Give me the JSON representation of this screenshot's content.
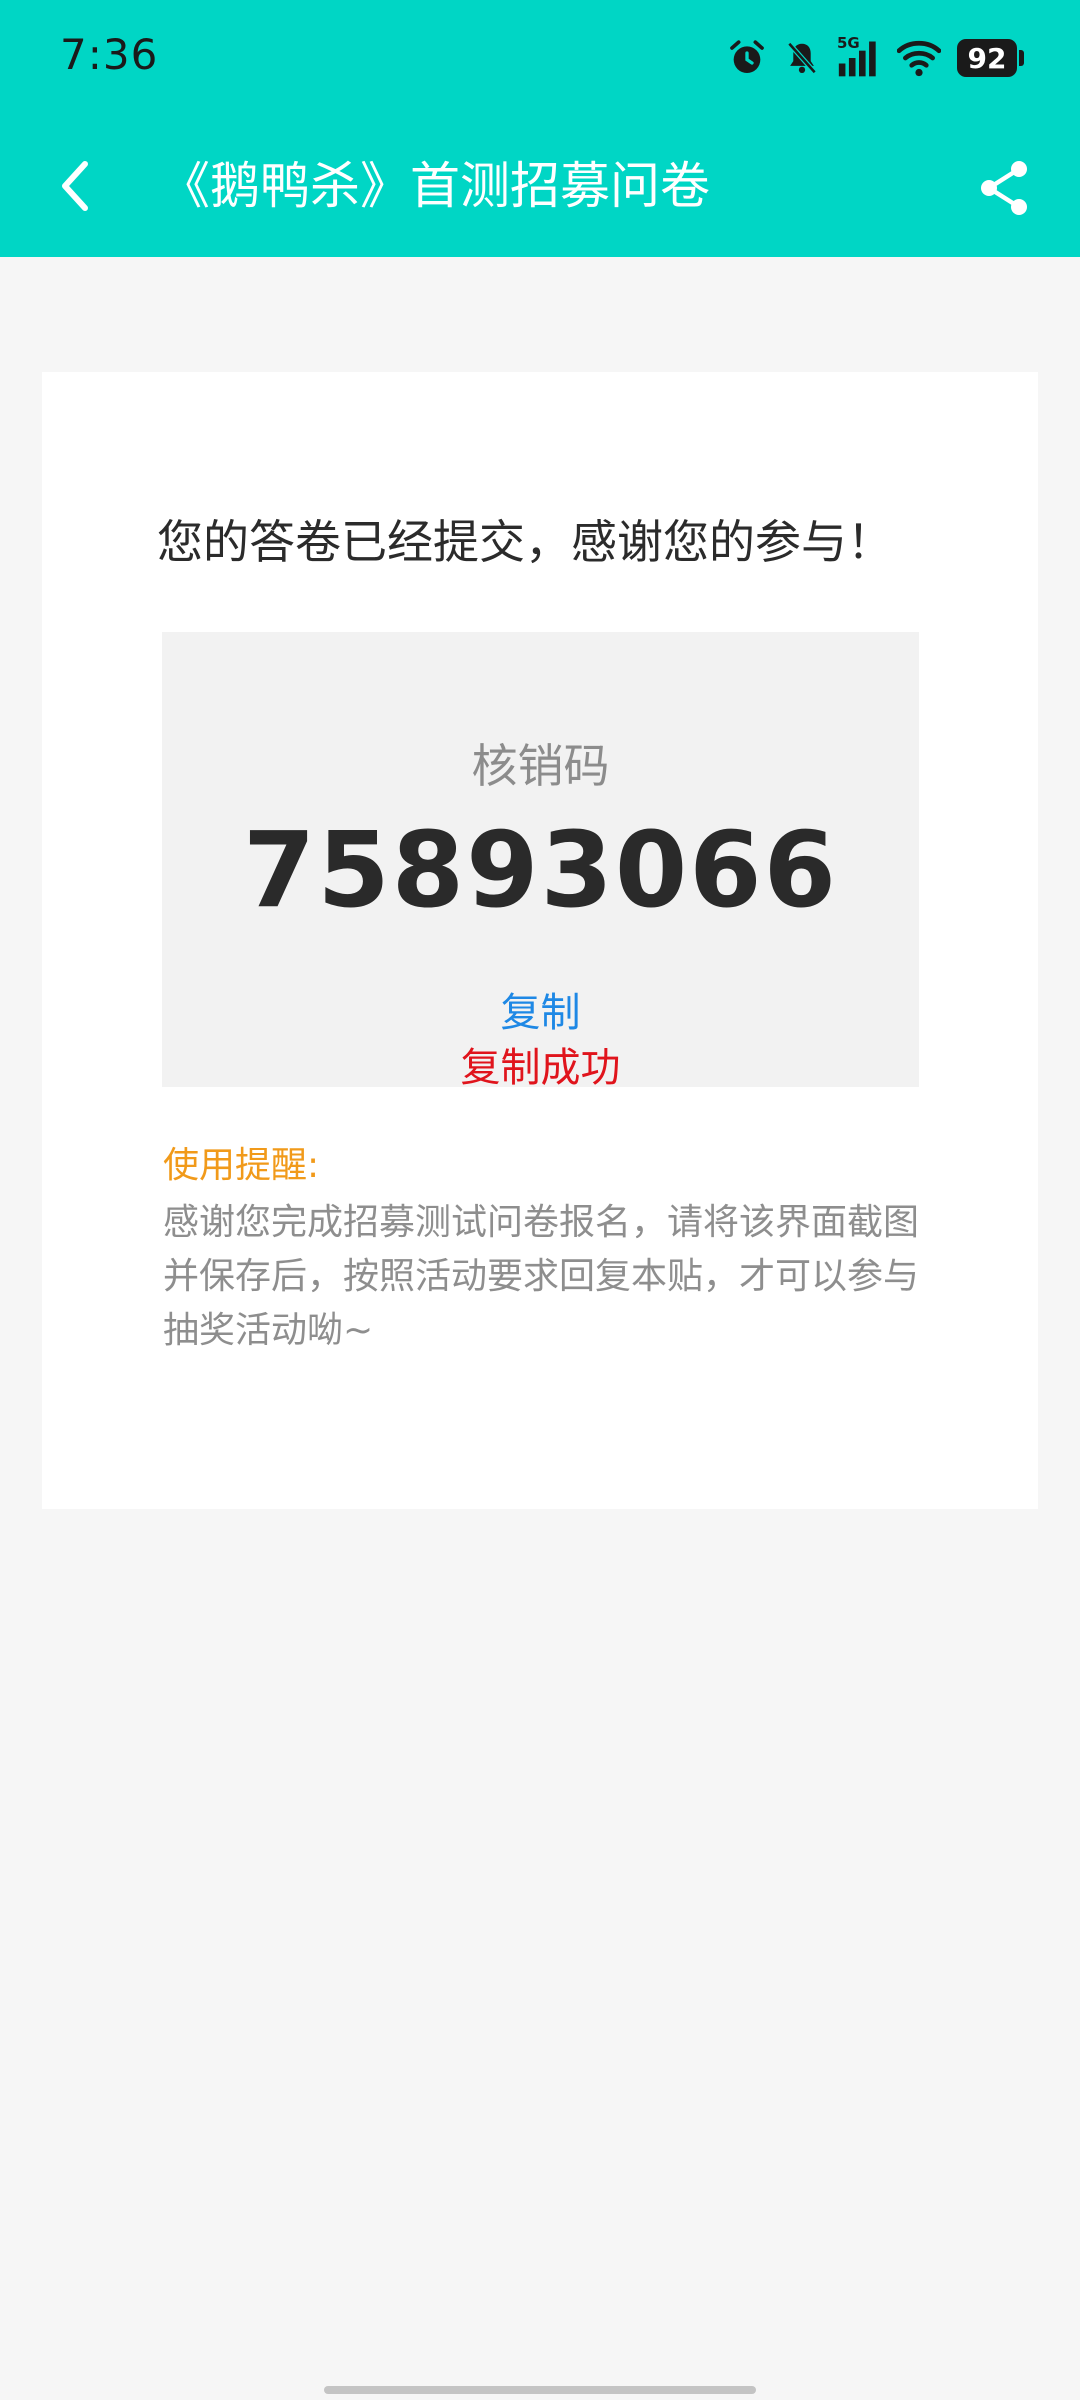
{
  "status_bar": {
    "time": "7:36",
    "network": "5G",
    "battery": "92",
    "icons": [
      "alarm-icon",
      "bell-off-icon",
      "signal-icon",
      "wifi-icon",
      "battery-icon"
    ]
  },
  "header": {
    "title": "《鹅鸭杀》首测招募问卷",
    "back_icon": "chevron-left-icon",
    "share_icon": "share-icon"
  },
  "result": {
    "heading": "您的答卷已经提交，感谢您的参与！",
    "code_label": "核销码",
    "code_value": "75893066",
    "copy_label": "复制",
    "copy_status": "复制成功"
  },
  "tips": {
    "title": "使用提醒:",
    "text": "感谢您完成招募测试问卷报名，请将该界面截图并保存后，按照活动要求回复本贴，才可以参与抽奖活动呦~"
  },
  "colors": {
    "header_bg": "#00d6c5",
    "page_bg": "#f6f6f6",
    "link": "#1e88e5",
    "success": "#e0141c",
    "tip_title": "#f19a1a"
  }
}
